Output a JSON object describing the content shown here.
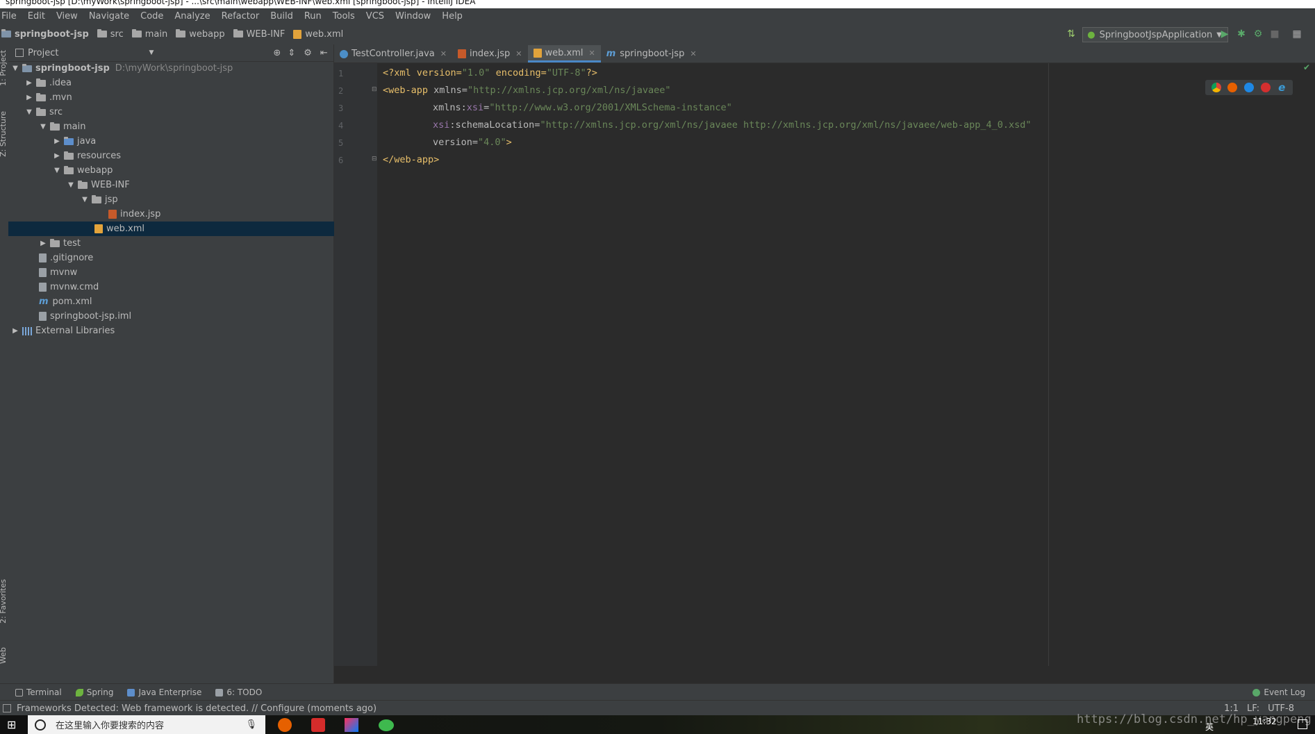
{
  "window": {
    "title": "springboot-jsp [D:\\myWork\\springboot-jsp] - ...\\src\\main\\webapp\\WEB-INF\\web.xml [springboot-jsp] - IntelliJ IDEA"
  },
  "menu": [
    "File",
    "Edit",
    "View",
    "Navigate",
    "Code",
    "Analyze",
    "Refactor",
    "Build",
    "Run",
    "Tools",
    "VCS",
    "Window",
    "Help"
  ],
  "breadcrumbs": [
    "springboot-jsp",
    "src",
    "main",
    "webapp",
    "WEB-INF",
    "web.xml"
  ],
  "run_config": "SpringbootJspApplication",
  "left_strip": {
    "project": "1: Project",
    "structure": "Z: Structure",
    "favorites": "2: Favorites",
    "web": "Web"
  },
  "project_panel": {
    "title": "Project"
  },
  "tree": [
    {
      "label": "springboot-jsp",
      "path": "D:\\myWork\\springboot-jsp"
    },
    {
      "label": ".idea"
    },
    {
      "label": ".mvn"
    },
    {
      "label": "src"
    },
    {
      "label": "main"
    },
    {
      "label": "java"
    },
    {
      "label": "resources"
    },
    {
      "label": "webapp"
    },
    {
      "label": "WEB-INF"
    },
    {
      "label": "jsp"
    },
    {
      "label": "index.jsp"
    },
    {
      "label": "web.xml"
    },
    {
      "label": "test"
    },
    {
      "label": ".gitignore"
    },
    {
      "label": "mvnw"
    },
    {
      "label": "mvnw.cmd"
    },
    {
      "label": "pom.xml"
    },
    {
      "label": "springboot-jsp.iml"
    },
    {
      "label": "External Libraries"
    }
  ],
  "tabs": [
    "TestController.java",
    "index.jsp",
    "web.xml",
    "springboot-jsp"
  ],
  "line_numbers": [
    "1",
    "2",
    "3",
    "4",
    "5",
    "6"
  ],
  "code": {
    "l1": {
      "a": "<?xml version=",
      "b": "\"1.0\"",
      "c": " encoding=",
      "d": "\"UTF-8\"",
      "e": "?>"
    },
    "l2": {
      "a": "<web-app",
      "b": " xmlns=",
      "c": "\"http://xmlns.jcp.org/xml/ns/javaee\""
    },
    "l3": {
      "a": "xmlns:",
      "b": "xsi",
      "c": "=",
      "d": "\"http://www.w3.org/2001/XMLSchema-instance\""
    },
    "l4": {
      "a": "xsi",
      "b": ":schemaLocation=",
      "c": "\"http://xmlns.jcp.org/xml/ns/javaee http://xmlns.jcp.org/xml/ns/javaee/web-app_4_0.xsd\""
    },
    "l5": {
      "a": "version=",
      "b": "\"4.0\"",
      "c": ">"
    },
    "l6": {
      "a": "</web-app>"
    }
  },
  "tool_windows": [
    "Terminal",
    "Spring",
    "Java Enterprise",
    "6: TODO"
  ],
  "event_log": "Event Log",
  "status": {
    "message": "Frameworks Detected: Web framework is detected. // Configure (moments ago)",
    "position": "1:1",
    "line_sep": "LF:",
    "encoding": "UTF-8"
  },
  "taskbar": {
    "search_placeholder": "在这里输入你要搜索的内容",
    "ime": "英",
    "clock": "11:32",
    "watermark": "https://blog.csdn.net/hp_yangpeng"
  }
}
